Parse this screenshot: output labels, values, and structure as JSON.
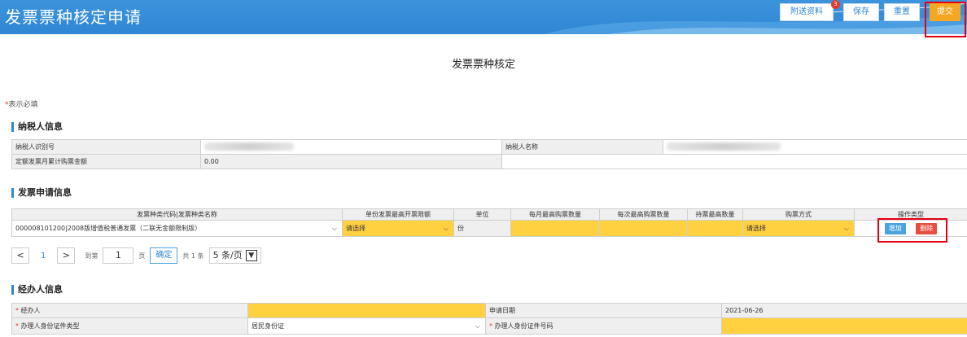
{
  "header": {
    "title": "发票票种核定申请",
    "buttons": {
      "attach": "附送资料",
      "attach_badge": "3",
      "save": "保存",
      "reset": "重置",
      "submit": "提交"
    }
  },
  "page_title": "发票票种核定",
  "required_note": {
    "star": "*",
    "text": "表示必填"
  },
  "taxpayer": {
    "section_title": "纳税人信息",
    "id_label": "纳税人识别号",
    "name_label": "纳税人名称",
    "amount_label": "定额发票月累计购票金额",
    "amount_value": "0.00"
  },
  "invoice": {
    "section_title": "发票申请信息",
    "headers": [
      "发票种类代码|发票种类名称",
      "单份发票最高开票限额",
      "单位",
      "每月最高购票数量",
      "每次最高购票数量",
      "持票最高数量",
      "购票方式",
      "操作类型"
    ],
    "row": {
      "type": "000008101200|2008版增值税普通发票（二联无金额限制版）",
      "limit": "请选择",
      "unit": "份",
      "monthly": "",
      "per_time": "",
      "max_hold": "",
      "method": "请选择",
      "add": "增加",
      "delete": "删除"
    }
  },
  "pager": {
    "prev": "<",
    "current": "1",
    "next": ">",
    "goto_label": "到第",
    "goto_value": "1",
    "page_unit": "页",
    "confirm": "确定",
    "total": "共 1 条",
    "page_size": "5 条/页"
  },
  "agent": {
    "section_title": "经办人信息",
    "agent_label": "经办人",
    "date_label": "申请日期",
    "date_value": "2021-06-26",
    "id_type_label": "办理人身份证件类型",
    "id_type_value": "居民身份证",
    "id_no_label": "办理人身份证件号码"
  }
}
